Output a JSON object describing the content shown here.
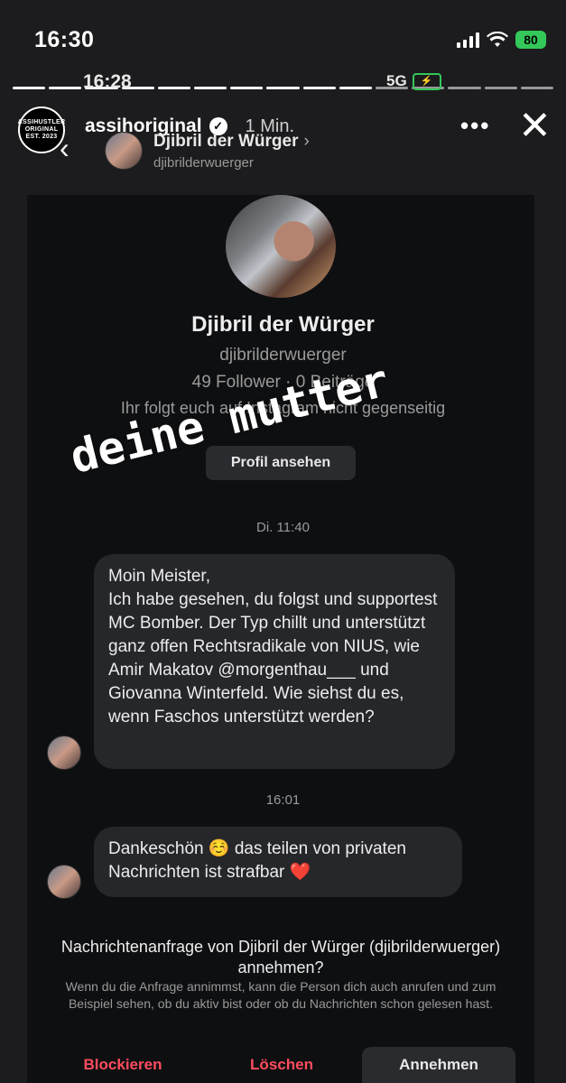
{
  "status_bar": {
    "time": "16:30",
    "battery": "80"
  },
  "inner_status": {
    "time": "16:28",
    "network": "5G"
  },
  "story": {
    "username": "assihoriginal",
    "posted": "1 Min.",
    "more_icon": "more-icon",
    "close_icon": "close-icon",
    "logo_text": "ASSIHUSTLER ORIGINAL EST. 2023 HATEFUCKMUSIC"
  },
  "dm_header": {
    "name": "Djibril der Würger",
    "handle": "djibrilderwuerger"
  },
  "profile": {
    "name": "Djibril der Würger",
    "handle": "djibrilderwuerger",
    "stats": "49 Follower · 0 Beiträge",
    "note": "Ihr folgt euch auf Instagram nicht gegenseitig",
    "view_button": "Profil ansehen"
  },
  "overlay_text": "deine mutter",
  "messages": [
    {
      "timestamp": "Di. 11:40",
      "lines": [
        "Moin Meister,",
        "Ich habe gesehen, du folgst und supportest MC Bomber. Der Typ chillt und unterstützt ganz offen Rechtsradikale von NIUS, wie Amir Makatov @morgenthau___ und Giovanna Winterfeld. Wie siehst du es, wenn Faschos unterstützt werden?"
      ]
    },
    {
      "timestamp": "16:01",
      "lines": [
        "Dankeschön ☺️ das teilen von privaten Nachrichten ist strafbar ❤️"
      ]
    }
  ],
  "request": {
    "title": "Nachrichtenanfrage von Djibril der Würger (djibrilderwuerger) annehmen?",
    "info": "Wenn du die Anfrage annimmst, kann die Person dich auch anrufen und zum Beispiel sehen, ob du aktiv bist oder ob du Nachrichten schon gelesen hast.",
    "block": "Blockieren",
    "delete": "Löschen",
    "accept": "Annehmen"
  },
  "colors": {
    "background": "#1c1c1e",
    "bubble": "#26272b",
    "danger": "#ff4d5e",
    "battery": "#34c759"
  }
}
